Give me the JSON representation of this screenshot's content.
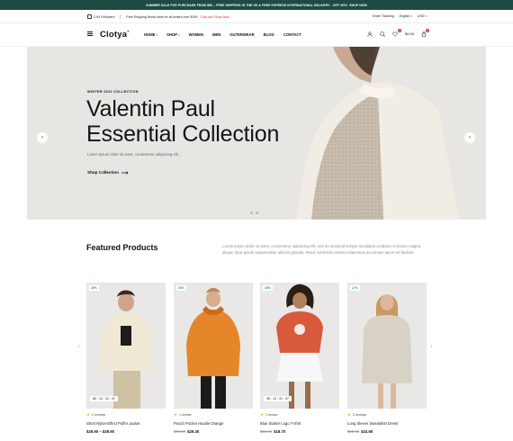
{
  "promo": {
    "text": "SUMMER SALE FOR PURCHASE FROM $50 – FREE SHIPPING IN THE US & FREE EXPRESS INTERNATIONAL DELIVERY - OFF 30%!",
    "cta": "SHOP NOW"
  },
  "utility": {
    "followers": "2.94 Followers",
    "shipping_text": "Free Shipping World wide for all orders over $199.",
    "shipping_link": "Click and Shop Now.",
    "order_tracking": "Order Tracking",
    "language": "English",
    "currency": "USD"
  },
  "header": {
    "logo": "Clotya",
    "logo_mark": "®",
    "nav": [
      {
        "label": "HOME",
        "dropdown": true
      },
      {
        "label": "SHOP",
        "dropdown": true
      },
      {
        "label": "WOMEN",
        "dropdown": false
      },
      {
        "label": "MEN",
        "dropdown": false
      },
      {
        "label": "OUTERWEAR",
        "dropdown": false
      },
      {
        "label": "BLOG",
        "dropdown": false
      },
      {
        "label": "CONTACT",
        "dropdown": false
      }
    ],
    "wishlist_count": "0",
    "cart_total": "$0.00",
    "cart_count": "0"
  },
  "hero": {
    "eyebrow": "WINTER 2022 COLLECTION",
    "title_line1": "Valentin Paul",
    "title_line2": "Essential Collection",
    "subtitle": "Lorem ipsum dolor sit amet, consectetur adipiscing elit...",
    "cta": "Shop Collection"
  },
  "featured": {
    "title": "Featured Products",
    "description": "Lorem ipsum dolor sit amet, consectetur adipiscing elit, sed do eiusmod tempor incididunt ut labore et dolore magna aliqua. Quis ipsum suspendisse ultrices gravida. Risus commodo viverra maecenas accumsan lacus vel facilisis."
  },
  "products": [
    {
      "discount": "26%",
      "timer": "60 : 13 : 31 : 47",
      "reviews": "2 reviews",
      "name": "Short Nylon-Effect Puffer Jacket",
      "old_price": "",
      "price": "$29.90 – $39.90"
    },
    {
      "discount": "33%",
      "timer": "",
      "reviews": "1 review",
      "name": "Pouch Pocket Hoodie Orange",
      "old_price": "$29.90",
      "price": "$29.30"
    },
    {
      "discount": "16%",
      "timer": "35 : 13 : 31 : 47",
      "reviews": "1 review",
      "name": "Blue Starter Logo T-shirt",
      "old_price": "$22.90",
      "price": "$18.70"
    },
    {
      "discount": "17%",
      "timer": "",
      "reviews": "2 reviews",
      "name": "Long Sleeve Sweatshirt Dress",
      "old_price": "$28.90",
      "price": "$24.90"
    }
  ],
  "colors": {
    "promo_bg": "#1f4a43",
    "accent_red": "#d6332f",
    "discount_green": "#2a9a74",
    "hero_bg": "#e7e6e3"
  }
}
